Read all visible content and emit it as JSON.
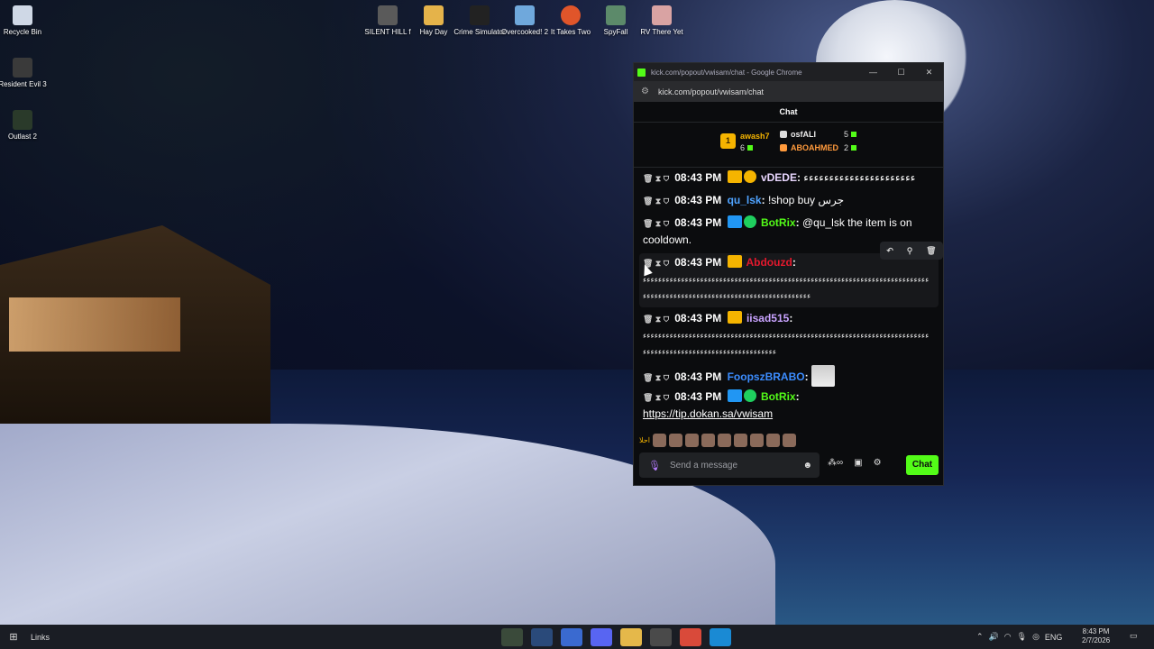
{
  "desktop": {
    "icons": [
      {
        "label": "Recycle Bin"
      },
      {
        "label": "Resident Evil 3"
      },
      {
        "label": "Outlast 2"
      },
      {
        "label": "SILENT HILL f"
      },
      {
        "label": "Hay Day"
      },
      {
        "label": "Crime Simulator"
      },
      {
        "label": "Overcooked! 2"
      },
      {
        "label": "It Takes Two"
      },
      {
        "label": "SpyFall"
      },
      {
        "label": "RV There Yet"
      }
    ]
  },
  "window": {
    "title": "kick.com/popout/vwisam/chat - Google Chrome",
    "url": "kick.com/popout/vwisam/chat",
    "controls": {
      "minimize": "—",
      "maximize": "☐",
      "close": "✕"
    }
  },
  "chat": {
    "header": "Chat",
    "leaderboard": [
      {
        "rank": "1",
        "name": "awash7",
        "count": "6"
      },
      {
        "name": "osfALI",
        "count": "5"
      },
      {
        "name": "ABOAHMED",
        "count": "2"
      }
    ],
    "messages": [
      {
        "time": "08:43 PM",
        "user": "vDEDE",
        "text": "ﺀﺀﺀﺀﺀﺀﺀﺀﺀﺀﺀﺀﺀﺀﺀﺀﺀﺀﺀﺀﺀﺀ"
      },
      {
        "time": "08:43 PM",
        "user": "qu_lsk",
        "text": "!shop buy جرس"
      },
      {
        "time": "08:43 PM",
        "user": "BotRix",
        "text": "@qu_lsk the item is on cooldown."
      },
      {
        "time": "08:43 PM",
        "user": "Abdouzd",
        "text": "ﺀﺀﺀﺀﺀﺀﺀﺀﺀﺀﺀﺀﺀﺀﺀﺀﺀﺀﺀﺀﺀﺀﺀﺀﺀﺀﺀﺀﺀﺀﺀﺀﺀﺀﺀﺀﺀﺀﺀﺀﺀﺀﺀﺀﺀﺀﺀﺀﺀﺀﺀﺀﺀﺀﺀﺀﺀﺀﺀﺀﺀﺀﺀﺀﺀﺀﺀﺀﺀﺀﺀﺀﺀﺀﺀﺀﺀﺀﺀﺀﺀﺀﺀﺀﺀﺀﺀﺀﺀﺀﺀﺀﺀﺀﺀﺀﺀﺀﺀﺀﺀﺀﺀﺀﺀﺀﺀﺀﺀﺀﺀﺀﺀﺀﺀﺀﺀﺀﺀ"
      },
      {
        "time": "08:43 PM",
        "user": "iisad515",
        "text": "ﺀﺀﺀﺀﺀﺀﺀﺀﺀﺀﺀﺀﺀﺀﺀﺀﺀﺀﺀﺀﺀﺀﺀﺀﺀﺀﺀﺀﺀﺀﺀﺀﺀﺀﺀﺀﺀﺀﺀﺀﺀﺀﺀﺀﺀﺀﺀﺀﺀﺀﺀﺀﺀﺀﺀﺀﺀﺀﺀﺀﺀﺀﺀﺀﺀﺀﺀﺀﺀﺀﺀﺀﺀﺀﺀﺀﺀﺀﺀﺀﺀﺀﺀﺀﺀﺀﺀﺀﺀﺀﺀﺀﺀﺀﺀﺀﺀﺀﺀﺀﺀﺀﺀﺀﺀﺀﺀﺀﺀﺀ"
      },
      {
        "time": "08:43 PM",
        "user": "FoopszBRABO",
        "text": ""
      },
      {
        "time": "08:43 PM",
        "user": "BotRix",
        "text": "https://tip.dokan.sa/vwisam"
      }
    ],
    "input_placeholder": "Send a message",
    "send_label": "Chat",
    "emote_prefix": "احلا"
  },
  "taskbar": {
    "links_label": "Links",
    "lang": "ENG",
    "time": "8:43 PM",
    "date": "2/7/2026"
  },
  "colors": {
    "kick_green": "#53fc18",
    "gold": "#f5b400"
  }
}
